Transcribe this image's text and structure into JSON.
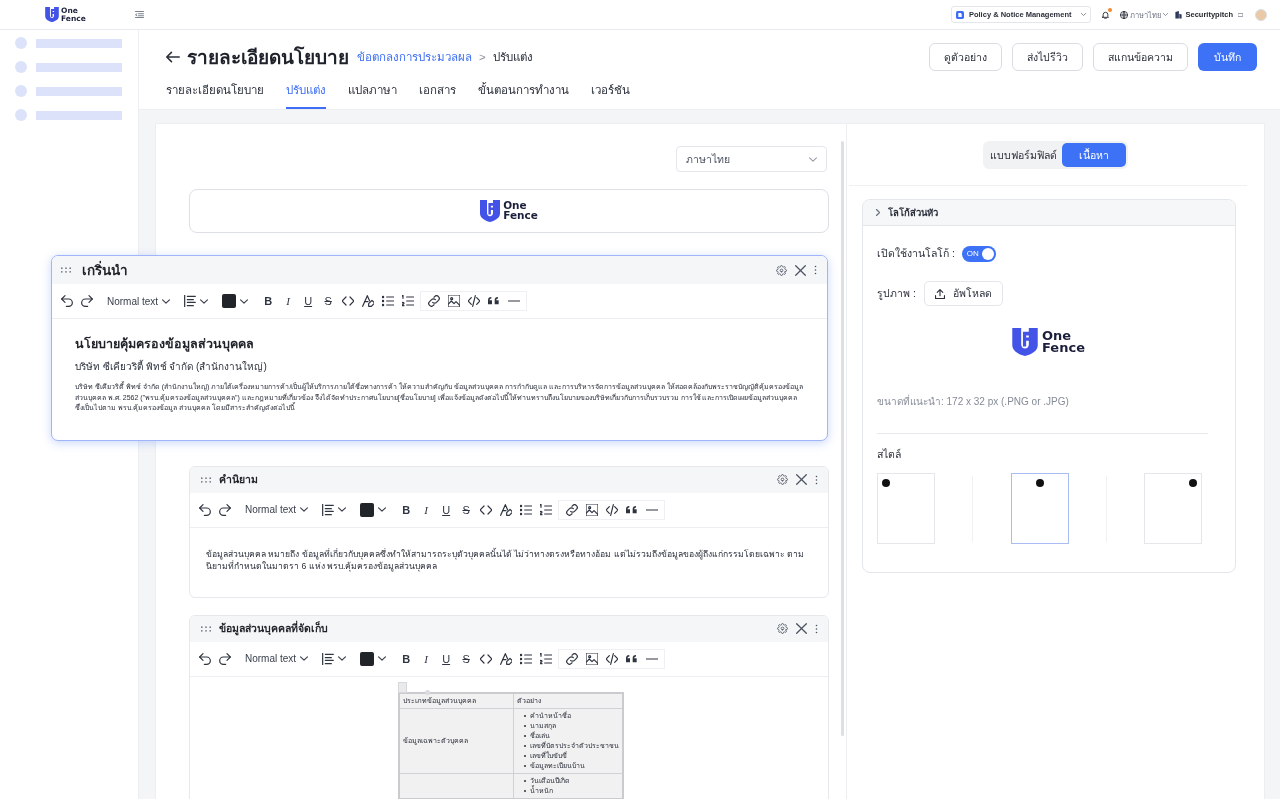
{
  "topbar": {
    "logo": {
      "line_1": "One",
      "line_2": "Fence"
    },
    "product": "Policy & Notice Management",
    "notifications": {
      "unread": true
    },
    "language": "ภาษาไทย",
    "organization": "Securitypitch"
  },
  "page_header": {
    "title": "รายละเอียดนโยบาย",
    "breadcrumb": [
      {
        "label": "ข้อตกลงการประมวลผล",
        "kind": "link"
      },
      {
        "label": ">",
        "kind": "separator"
      },
      {
        "label": "ปรับแต่ง",
        "kind": "current"
      }
    ],
    "actions": [
      {
        "label": "ดูตัวอย่าง",
        "kind": "secondary"
      },
      {
        "label": "ส่งไปรีวิว",
        "kind": "secondary"
      },
      {
        "label": "สแกนข้อความ",
        "kind": "secondary"
      },
      {
        "label": "บันทึก",
        "kind": "primary"
      }
    ]
  },
  "tabs": [
    {
      "label": "รายละเอียดนโยบาย",
      "selected": false
    },
    {
      "label": "ปรับแต่ง",
      "selected": true
    },
    {
      "label": "แปลภาษา",
      "selected": false
    },
    {
      "label": "เอกสาร",
      "selected": false
    },
    {
      "label": "ขั้นตอนการทำงาน",
      "selected": false
    },
    {
      "label": "เวอร์ชัน",
      "selected": false
    }
  ],
  "editor": {
    "language": "ภาษาไทย",
    "logo": {
      "line_1": "One",
      "line_2": "Fence"
    },
    "sections": [
      {
        "title": "เกริ่นนำ",
        "dragging": true,
        "toolbar": {
          "text_style": "Normal text",
          "marks": [
            {
              "kind": "bold",
              "label": "B"
            },
            {
              "kind": "italic",
              "label": "I"
            },
            {
              "kind": "underline",
              "label": "U"
            },
            {
              "kind": "strike",
              "label": "S"
            }
          ]
        },
        "content": [
          {
            "kind": "heading",
            "text": "นโยบายคุ้มครองข้อมูลส่วนบุคคล"
          },
          {
            "kind": "subheading",
            "text": "บริษัท ซีเคียวริตี้ พิทช์ จำกัด (สำนักงานใหญ่)"
          },
          {
            "kind": "smallprint",
            "text": "บริษัท ซีเคียวริตี้ พิทช์ จำกัด (สำนักงานใหญ่) ภายใต้เครื่องหมายการค้า/เป็นผู้ให้บริการภายใต้ชื่อทางการค้า ให้ความสำคัญกับ ข้อมูลส่วนบุคคล การกำกับดูแล และการบริหารจัดการข้อมูลส่วนบุคคล ให้สอดคล้องกับพระราชบัญญัติคุ้มครองข้อมูลส่วนบุคคล พ.ศ. 2562 (\"พรบ.คุ้มครองข้อมูลส่วนบุคคล\") และกฎหมายที่เกี่ยวข้อง จึงได้จัดทำประกาศนโยบาย[ชื่อนโยบาย] เพื่อแจ้งข้อมูลดังต่อไปนี้ให้ท่านทราบถึงนโยบายของบริษัทเกี่ยวกับการเก็บรวบรวม การใช้ และการเปิดเผยข้อมูลส่วนบุคคล ซึ่งเป็นไปตาม พรบ.คุ้มครองข้อมูล ส่วนบุคคล โดยมีสาระสำคัญดังต่อไปนี้"
          }
        ]
      },
      {
        "title": "คำนิยาม",
        "dragging": false,
        "toolbar": {
          "text_style": "Normal text",
          "marks": [
            {
              "kind": "bold",
              "label": "B"
            },
            {
              "kind": "italic",
              "label": "I"
            },
            {
              "kind": "underline",
              "label": "U"
            },
            {
              "kind": "strike",
              "label": "S"
            }
          ]
        },
        "content": [
          {
            "kind": "body",
            "text": "ข้อมูลส่วนบุคคล หมายถึง ข้อมูลที่เกี่ยวกับบุคคลซึ่งทำให้สามารถระบุตัวบุคคลนั้นได้ ไม่ว่าทางตรงหรือทางอ้อม แต่ไม่รวมถึงข้อมูลของผู้ถึงแก่กรรมโดยเฉพาะ ตามนิยามที่กำหนดในมาตรา 6 แห่ง พรบ.คุ้มครองข้อมูลส่วนบุคคล"
          }
        ]
      },
      {
        "title": "ข้อมูลส่วนบุคคลที่จัดเก็บ",
        "dragging": false,
        "toolbar": {
          "text_style": "Normal text",
          "marks": [
            {
              "kind": "bold",
              "label": "B"
            },
            {
              "kind": "italic",
              "label": "I"
            },
            {
              "kind": "underline",
              "label": "U"
            },
            {
              "kind": "strike",
              "label": "S"
            }
          ]
        },
        "content": [
          {
            "kind": "table",
            "columns": [
              "ประเภทข้อมูลส่วนบุคคล",
              "ตัวอย่าง"
            ],
            "rows": [
              {
                "category": "ข้อมูลเฉพาะตัวบุคคล",
                "examples": [
                  "คำนำหน้าชื่อ",
                  "นามสกุล",
                  "ชื่อเล่น",
                  "เลขที่บัตรประจำตัวประชาชน",
                  "เลขที่ใบขับขี่",
                  "ข้อมูลทะเบียนบ้าน"
                ]
              },
              {
                "examples": [
                  "วันเดือนปีเกิด",
                  "น้ำหนัก"
                ]
              }
            ]
          }
        ]
      }
    ]
  },
  "side_panel": {
    "view_modes": [
      {
        "label": "แบบฟอร์มฟิลด์",
        "selected": false
      },
      {
        "label": "เนื้อหา",
        "selected": true
      }
    ],
    "header_logo": {
      "title": "โลโก้ส่วนหัว",
      "enable_label": "เปิดใช้งานโลโก้ :",
      "enabled": true,
      "switch_text": "ON",
      "image_label": "รูปภาพ :",
      "upload_label": "อัพโหลด",
      "logo": {
        "line_1": "One",
        "line_2": "Fence"
      },
      "hint": "ขนาดที่แนะนำ: 172 x 32 px (.PNG or .JPG)",
      "style_label": "สไตล์",
      "styles": [
        {
          "kind": "left",
          "selected": false
        },
        {
          "kind": "center",
          "selected": true
        },
        {
          "kind": "right",
          "selected": false
        }
      ]
    }
  }
}
